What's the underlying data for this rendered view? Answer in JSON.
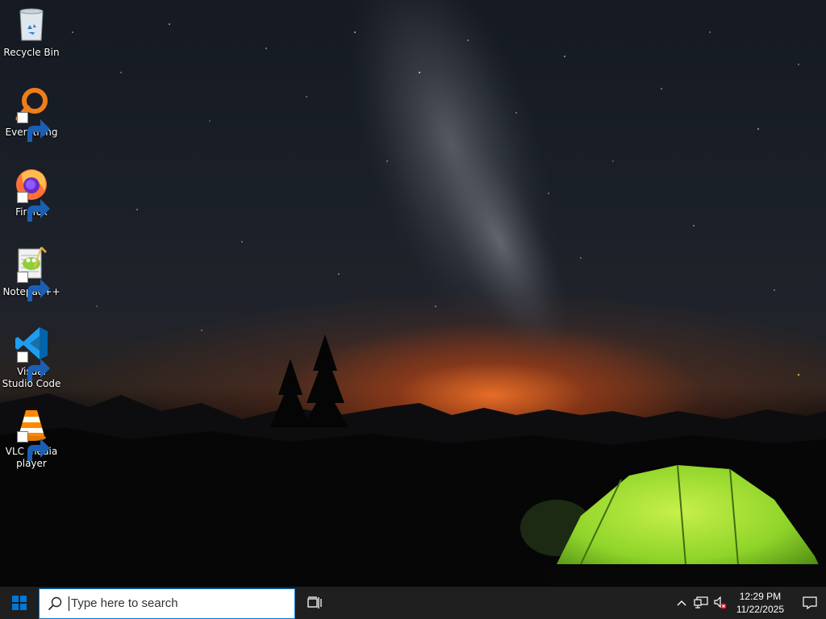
{
  "desktop": {
    "icons": [
      {
        "label": "Recycle Bin",
        "icon": "recycle-bin-icon"
      },
      {
        "label": "Everything",
        "icon": "everything-search-icon"
      },
      {
        "label": "Firefox",
        "icon": "firefox-icon"
      },
      {
        "label": "Notepad++",
        "icon": "notepad-plus-plus-icon"
      },
      {
        "label": "Visual Studio Code",
        "icon": "vscode-icon"
      },
      {
        "label": "VLC media player",
        "icon": "vlc-icon"
      }
    ]
  },
  "taskbar": {
    "start_icon": "windows-logo-icon",
    "search": {
      "placeholder": "Type here to search"
    },
    "task_view_icon": "task-view-icon",
    "tray": {
      "show_hidden_icon": "chevron-up-icon",
      "network_icon": "network-icon",
      "volume_icon": "volume-muted-icon",
      "time": "12:29 PM",
      "date": "11/22/2025",
      "notification_icon": "action-center-icon"
    }
  },
  "colors": {
    "taskbar_bg": "#1f1f1f",
    "search_border": "#0078d7",
    "accent": "#0078d7"
  }
}
